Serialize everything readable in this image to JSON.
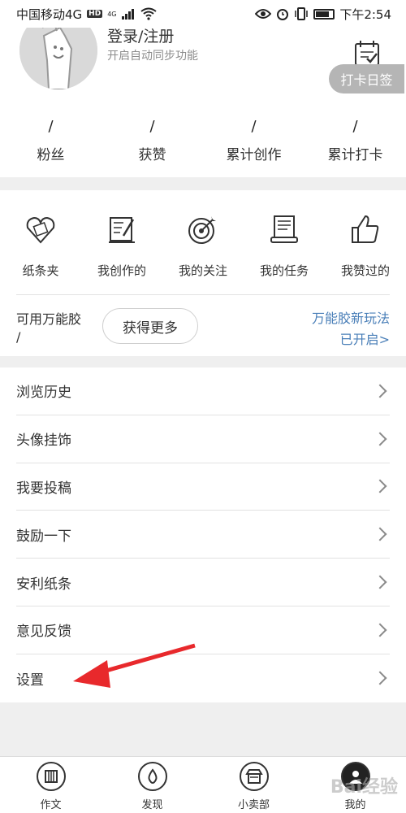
{
  "status_bar": {
    "carrier": "中国移动4G",
    "hd": "HD",
    "network": "4G",
    "time": "下午2:54"
  },
  "profile": {
    "login": "登录/注册",
    "sync": "开启自动同步功能",
    "checkin": "打卡日签"
  },
  "stats": [
    {
      "value": "/",
      "label": "粉丝"
    },
    {
      "value": "/",
      "label": "获赞"
    },
    {
      "value": "/",
      "label": "累计创作"
    },
    {
      "value": "/",
      "label": "累计打卡"
    }
  ],
  "shortcuts": [
    {
      "label": "纸条夹",
      "icon": "folder-heart-icon"
    },
    {
      "label": "我创作的",
      "icon": "document-pen-icon"
    },
    {
      "label": "我的关注",
      "icon": "target-icon"
    },
    {
      "label": "我的任务",
      "icon": "scroll-icon"
    },
    {
      "label": "我赞过的",
      "icon": "thumbs-up-icon"
    }
  ],
  "glue": {
    "label": "可用万能胶",
    "value": "/",
    "get_more": "获得更多",
    "new_play_line1": "万能胶新玩法",
    "new_play_line2": "已开启>"
  },
  "menu": [
    {
      "label": "浏览历史"
    },
    {
      "label": "头像挂饰"
    },
    {
      "label": "我要投稿"
    },
    {
      "label": "鼓励一下"
    },
    {
      "label": "安利纸条"
    },
    {
      "label": "意见反馈"
    },
    {
      "label": "设置"
    }
  ],
  "bottom_nav": [
    {
      "label": "作文",
      "icon": "book-icon"
    },
    {
      "label": "发现",
      "icon": "drop-icon"
    },
    {
      "label": "小卖部",
      "icon": "shop-icon"
    },
    {
      "label": "我的",
      "icon": "user-icon",
      "active": true
    }
  ],
  "watermark": "Bai经验",
  "colors": {
    "accent_blue": "#4a7fb8",
    "annotation_red": "#e8292c",
    "checkin_gray": "#b5b5b5"
  }
}
